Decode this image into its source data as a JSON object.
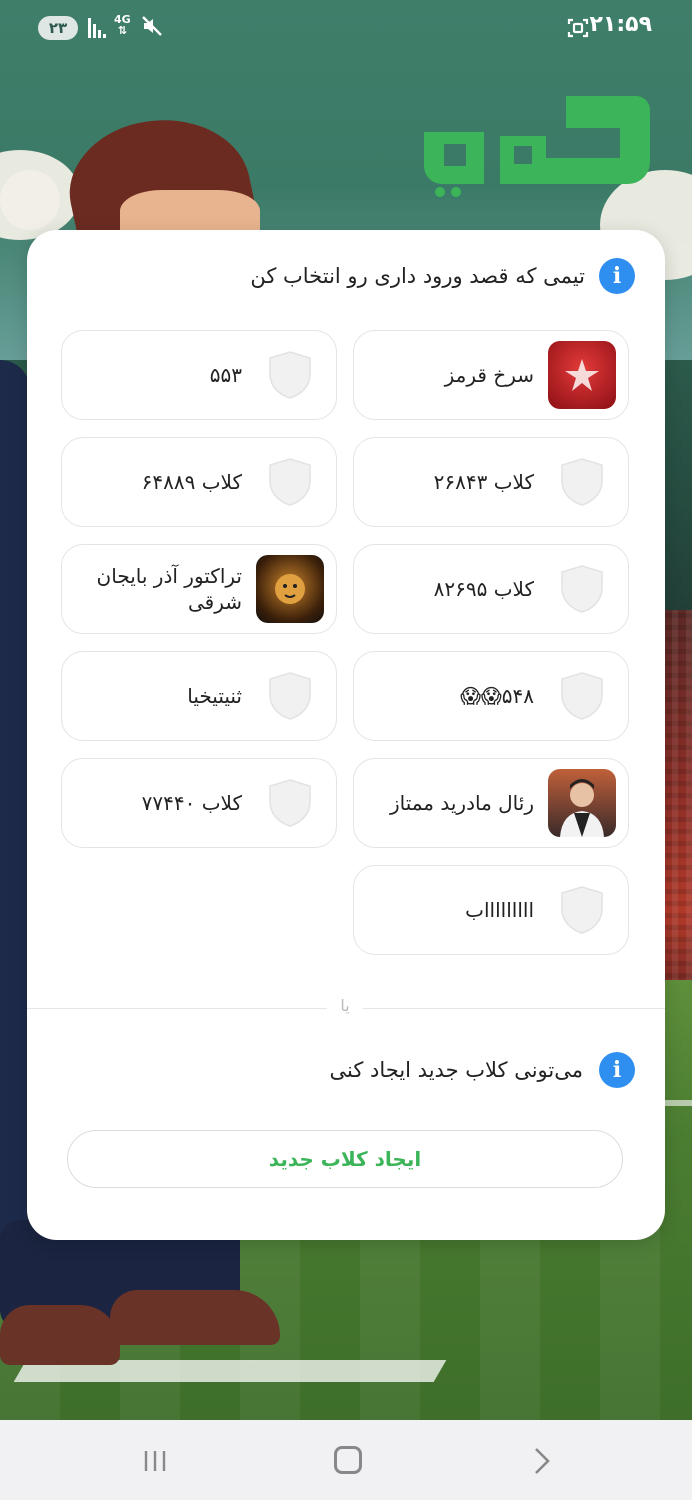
{
  "status_bar": {
    "sim_label": "۲۳",
    "network": "4G",
    "time": "۲۱:۵۹"
  },
  "app": {
    "logo_text": "کلوپی",
    "brand_color": "#3cb55a"
  },
  "select_team": {
    "header": "تیمی که قصد ورود داری رو انتخاب کن",
    "teams": [
      {
        "name": "سرخ قرمز",
        "badge": "persepolis-logo"
      },
      {
        "name": "۵۵۳",
        "badge": "shield-icon"
      },
      {
        "name": "کلاب ۲۶۸۴۳",
        "badge": "shield-icon"
      },
      {
        "name": "کلاب ۶۴۸۸۹",
        "badge": "shield-icon"
      },
      {
        "name": "کلاب ۸۲۶۹۵",
        "badge": "shield-icon"
      },
      {
        "name": "تراکتور آذر بایجان شرقی",
        "badge": "lion-logo"
      },
      {
        "name": "۵۴۸😱😱",
        "badge": "shield-icon"
      },
      {
        "name": "ثنیتیخیا",
        "badge": "shield-icon"
      },
      {
        "name": "رئال مادرید ممتاز",
        "badge": "person-photo"
      },
      {
        "name": "کلاب ۷۷۴۴۰",
        "badge": "shield-icon"
      },
      {
        "name": "اااااااااب",
        "badge": "shield-icon"
      }
    ]
  },
  "divider_text": "یا",
  "create": {
    "info_text": "می‌تونی کلاب جدید ایجاد کنی",
    "button_label": "ایجاد کلاب جدید"
  }
}
